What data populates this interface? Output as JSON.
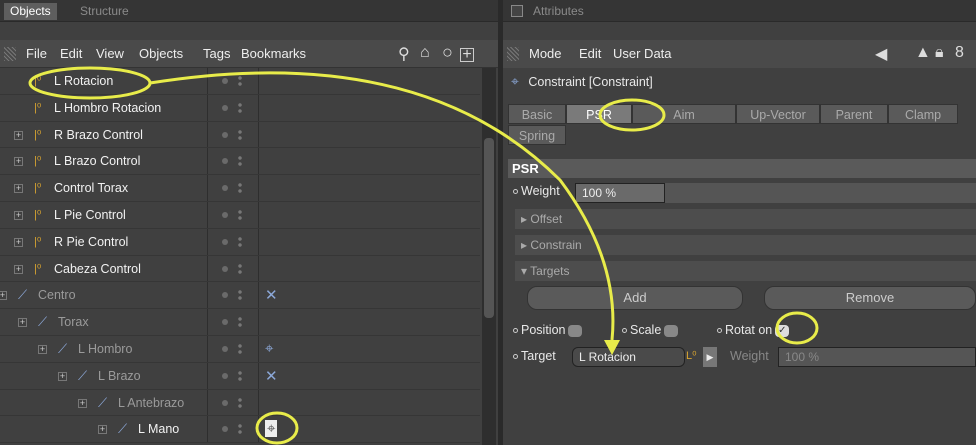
{
  "left": {
    "tabs": [
      "Objects",
      "Structure"
    ],
    "menu": [
      "File",
      "Edit",
      "View",
      "Objects",
      "Tags",
      "Bookmarks"
    ],
    "tree": [
      {
        "name": "L Rotacion",
        "style": "hl",
        "indent": 34,
        "icon": "null",
        "tag": ""
      },
      {
        "name": "L Hombro Rotacion",
        "style": "hl",
        "indent": 34,
        "icon": "null",
        "tag": ""
      },
      {
        "name": "R Brazo Control",
        "style": "hl",
        "indent": 34,
        "icon": "null",
        "tag": "",
        "plus": true
      },
      {
        "name": "L Brazo Control",
        "style": "hl",
        "indent": 34,
        "icon": "null",
        "tag": "",
        "plus": true
      },
      {
        "name": "Control Torax",
        "style": "hl",
        "indent": 34,
        "icon": "null",
        "tag": "",
        "plus": true
      },
      {
        "name": "L Pie Control",
        "style": "hl",
        "indent": 34,
        "icon": "null",
        "tag": "",
        "plus": true
      },
      {
        "name": "R Pie Control",
        "style": "hl",
        "indent": 34,
        "icon": "null",
        "tag": "",
        "plus": true
      },
      {
        "name": "Cabeza Control",
        "style": "hl",
        "indent": 34,
        "icon": "null",
        "tag": "",
        "plus": true
      },
      {
        "name": "Centro",
        "style": "dim",
        "indent": 18,
        "icon": "bone",
        "tag": "cross",
        "plus": true
      },
      {
        "name": "Torax",
        "style": "dim",
        "indent": 38,
        "icon": "bone",
        "tag": "",
        "plus": true
      },
      {
        "name": "L Hombro",
        "style": "dim",
        "indent": 58,
        "icon": "bone",
        "tag": "pin",
        "plus": true
      },
      {
        "name": "L Brazo",
        "style": "dim",
        "indent": 78,
        "icon": "bone",
        "tag": "cross",
        "plus": true
      },
      {
        "name": "L Antebrazo",
        "style": "dim",
        "indent": 98,
        "icon": "bone",
        "tag": "",
        "plus": true
      },
      {
        "name": "L Mano",
        "style": "hl",
        "indent": 118,
        "icon": "bone",
        "tag": "pin-selected",
        "plus": true
      }
    ]
  },
  "right": {
    "title": "Attributes",
    "menu": [
      "Mode",
      "Edit",
      "User Data"
    ],
    "object_label": "Constraint [Constraint]",
    "tabs_row1": [
      "Basic",
      "PSR",
      "Aim",
      "Up-Vector",
      "Parent",
      "Clamp"
    ],
    "tabs_row2": [
      "Spring"
    ],
    "active_tab": "PSR",
    "section_title": "PSR",
    "weight_label": "Weight",
    "weight_value": "100 %",
    "offset_label": "Offset",
    "constrain_label": "Constrain",
    "targets_label": "Targets",
    "add_label": "Add",
    "remove_label": "Remove",
    "position_label": "Position",
    "scale_label": "Scale",
    "rotation_label": "Rotat on",
    "target_label": "Target",
    "target_value": "L Rotacion",
    "target_weight_label": "Weight",
    "target_weight_value": "100 %"
  }
}
